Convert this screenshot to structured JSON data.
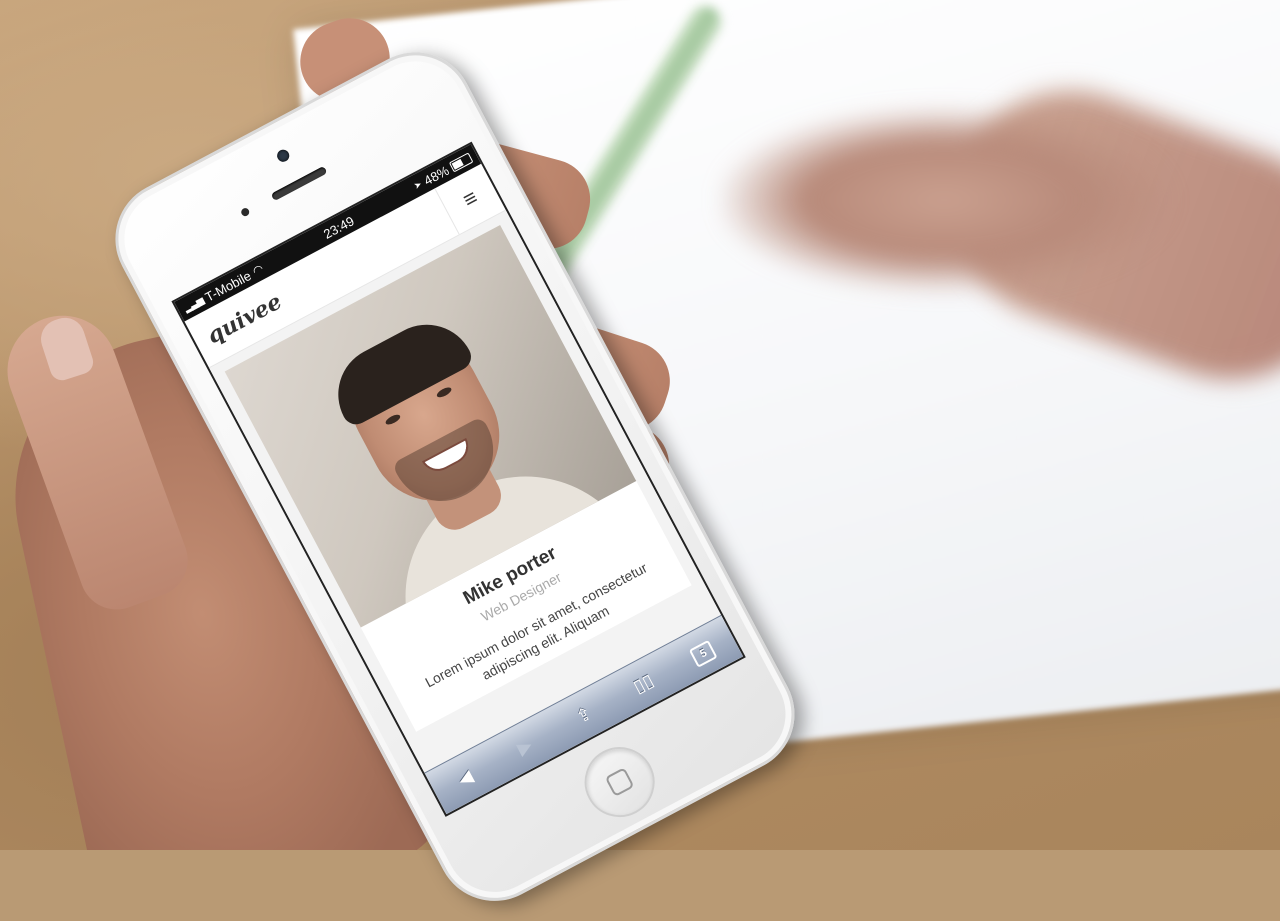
{
  "status_bar": {
    "carrier": "T-Mobile",
    "time": "23:49",
    "battery": "48%",
    "icons": [
      "signal-icon",
      "wifi-icon",
      "location-icon",
      "battery-icon"
    ]
  },
  "site": {
    "logo": "quivee",
    "menu_icon": "hamburger-icon"
  },
  "profile": {
    "name": "Mike porter",
    "role": "Web Designer",
    "bio": "Lorem ipsum dolor sit amet, consectetur adipiscing elit. Aliquam"
  },
  "safari_toolbar": {
    "back_icon": "back-arrow-icon",
    "forward_icon": "forward-arrow-icon",
    "share_icon": "share-icon",
    "bookmarks_icon": "bookmarks-icon",
    "tabs_count": "5"
  },
  "colors": {
    "toolbar_top": "#d2d9e4",
    "toolbar_bottom": "#8d9bb3",
    "phone_body": "#f1f1f1"
  }
}
